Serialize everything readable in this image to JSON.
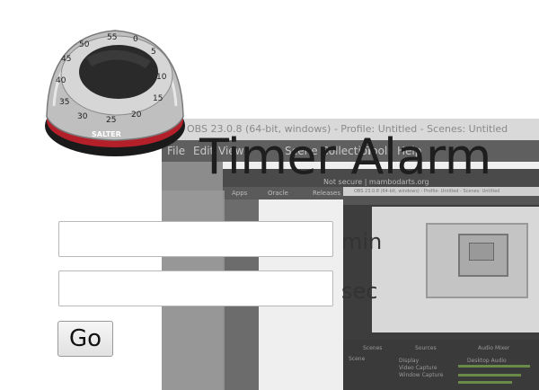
{
  "app": {
    "title": "Timer Alarm",
    "minutes_field": {
      "value": "",
      "unit_label": "min"
    },
    "seconds_field": {
      "value": "",
      "unit_label": "sec"
    },
    "go_label": "Go"
  },
  "kitchen_timer": {
    "brand": "SALTER",
    "dial_numbers": [
      "55",
      "0",
      "5",
      "10",
      "15",
      "20",
      "25",
      "30",
      "35",
      "40",
      "45",
      "50"
    ]
  },
  "background_window": {
    "title": "OBS 23.0.8 (64-bit, windows) - Profile: Untitled - Scenes: Untitled",
    "menu": [
      "File",
      "Edit",
      "View",
      "Profile",
      "Scene Collection",
      "Tools",
      "Help"
    ],
    "address": "Not secure  |  mambodarts.org",
    "bookmarks": [
      "Apps",
      "Oracle",
      "Releases"
    ],
    "nested_title": "OBS 23.0.8 (64-bit, windows) - Profile: Untitled - Scenes: Untitled",
    "docks": [
      "Scenes",
      "Sources",
      "Audio Mixer"
    ],
    "scene_item": "Scene",
    "sources": [
      "Display",
      "Video Capture",
      "Window Capture"
    ],
    "mixer_item": "Desktop Audio"
  },
  "colors": {
    "obs_background": "#8c8c8c",
    "title_text": "#1e1e1e",
    "button_bg": "#e9e9e9",
    "timer_red": "#b3202a",
    "timer_black": "#1a1a1a"
  }
}
